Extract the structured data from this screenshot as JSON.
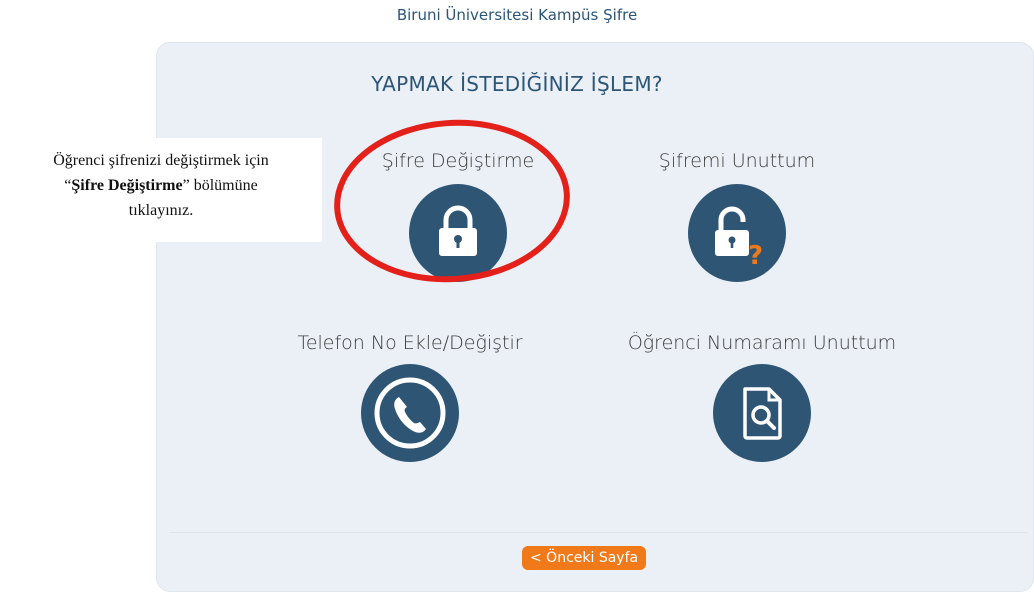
{
  "header": {
    "site_title": "Biruni Üniversitesi Kampüs Şifre"
  },
  "panel": {
    "question": "YAPMAK İSTEDİĞİNİZ İŞLEM?",
    "options": [
      {
        "label": "Şifre Değiştirme",
        "icon": "lock-icon"
      },
      {
        "label": "Şifremi Unuttum",
        "icon": "unlock-question-icon"
      },
      {
        "label": "Telefon No Ekle/Değiştir",
        "icon": "phone-icon"
      },
      {
        "label": "Öğrenci Numaramı Unuttum",
        "icon": "document-search-icon"
      }
    ],
    "back_button": "< Önceki Sayfa"
  },
  "annotation": {
    "line1": "Öğrenci şifrenizi değiştirmek için",
    "quote_open": "“",
    "bold_text": "Şifre Değiştirme",
    "quote_close_rest": "” bölümüne",
    "line3": "tıklayınız.",
    "highlight_color": "#e4201b"
  },
  "colors": {
    "brand_dark": "#2f5574",
    "accent_orange": "#f07a1a",
    "panel_bg": "#eaf0f6"
  }
}
